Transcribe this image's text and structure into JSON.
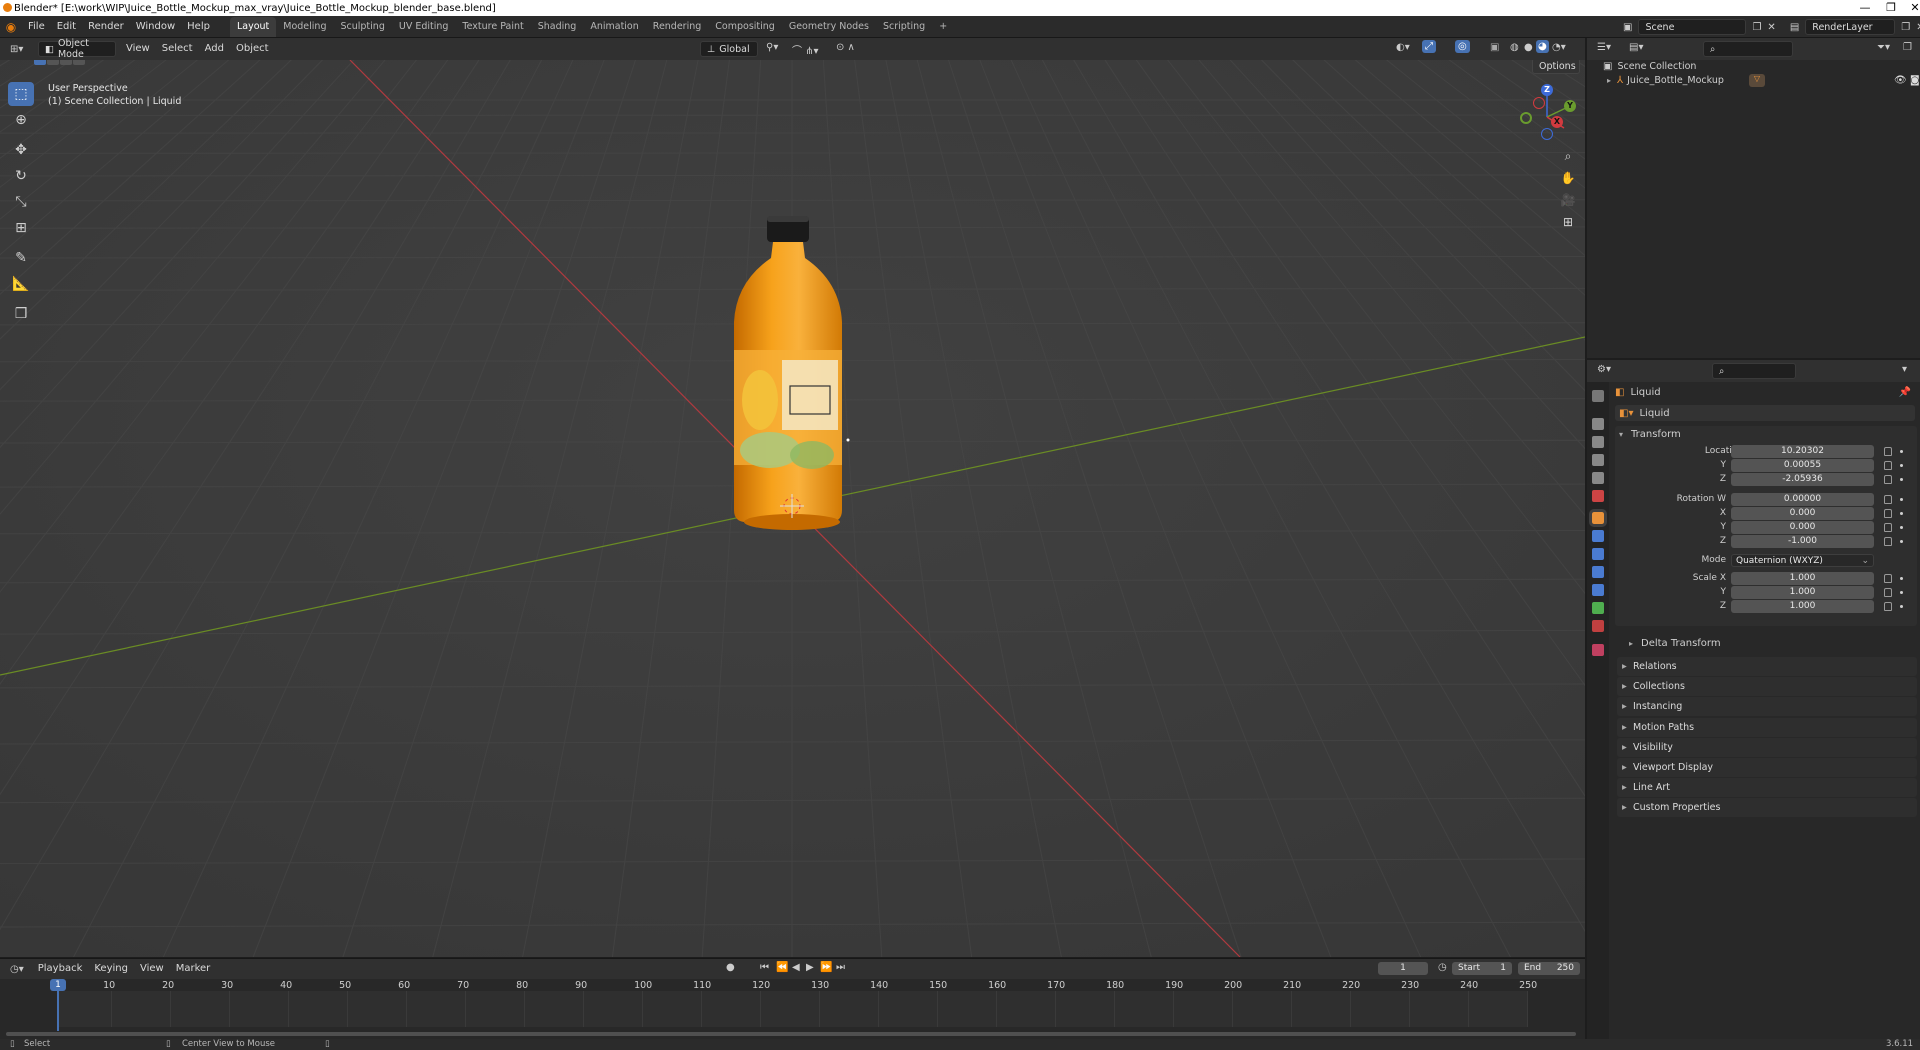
{
  "window": {
    "title": "Blender* [E:\\work\\WIP\\Juice_Bottle_Mockup_max_vray\\Juice_Bottle_Mockup_blender_base.blend]",
    "minimize_glyph": "—",
    "maximize_glyph": "❐",
    "close_glyph": "✕"
  },
  "menus": [
    "File",
    "Edit",
    "Render",
    "Window",
    "Help"
  ],
  "workspaces": [
    "Layout",
    "Modeling",
    "Sculpting",
    "UV Editing",
    "Texture Paint",
    "Shading",
    "Animation",
    "Rendering",
    "Compositing",
    "Geometry Nodes",
    "Scripting"
  ],
  "active_workspace": "Layout",
  "add_workspace": "+",
  "scene": {
    "label": "Scene",
    "layer": "RenderLayer"
  },
  "viewport_header": {
    "mode": "Object Mode",
    "menus": [
      "View",
      "Select",
      "Add",
      "Object"
    ],
    "orientation": "Global",
    "options": "Options"
  },
  "viewport_info": {
    "line1": "User Perspective",
    "line2": "(1) Scene Collection | Liquid"
  },
  "gizmo": {
    "x": "X",
    "y": "Y",
    "z": "Z"
  },
  "outliner": {
    "root": "Scene Collection",
    "items": [
      {
        "label": "Juice_Bottle_Mockup"
      }
    ]
  },
  "properties": {
    "object_name": "Liquid",
    "data_name": "Liquid",
    "transform_label": "Transform",
    "location": {
      "label": "Location X",
      "x": "10.20302",
      "y": "0.00055",
      "z": "-2.05936"
    },
    "rotation": {
      "label": "Rotation W",
      "w": "0.00000",
      "x": "0.000",
      "y": "0.000",
      "z": "-1.000"
    },
    "axis_labels": {
      "x": "X",
      "y": "Y",
      "z": "Z"
    },
    "mode": {
      "label": "Mode",
      "value": "Quaternion (WXYZ)"
    },
    "scale": {
      "label": "Scale X",
      "x": "1.000",
      "y": "1.000",
      "z": "1.000"
    },
    "delta_transform": "Delta Transform",
    "panels": [
      "Relations",
      "Collections",
      "Instancing",
      "Motion Paths",
      "Visibility",
      "Viewport Display",
      "Line Art",
      "Custom Properties"
    ]
  },
  "timeline": {
    "menus": [
      "Playback",
      "Keying",
      "View",
      "Marker"
    ],
    "current_frame": "1",
    "start_label": "Start",
    "start": "1",
    "end_label": "End",
    "end": "250",
    "frame_marks": [
      "10",
      "20",
      "30",
      "40",
      "50",
      "60",
      "70",
      "80",
      "90",
      "100",
      "110",
      "120",
      "130",
      "140",
      "150",
      "160",
      "170",
      "180",
      "190",
      "200",
      "210",
      "220",
      "230",
      "240",
      "250"
    ]
  },
  "statusbar": {
    "select": "Select",
    "center": "Center View to Mouse",
    "version": "3.6.11"
  },
  "colors": {
    "accent": "#4772b3",
    "x_axis": "#c2383f",
    "y_axis": "#6a8c24",
    "bottle": "#f59a12"
  }
}
